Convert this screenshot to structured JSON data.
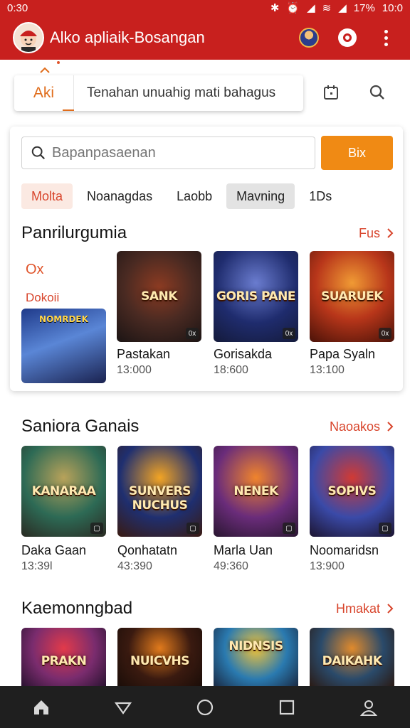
{
  "status": {
    "time": "0:30",
    "battery": "17%",
    "clock": "10:0"
  },
  "app": {
    "title": "Alko apliaik-Bosangan"
  },
  "search": {
    "tab_label": "Aki",
    "query": "Tenahan unuahig mati bahagus"
  },
  "featured": {
    "search_placeholder": "Bapanpasaenan",
    "button_label": "Bix",
    "chips": [
      {
        "label": "Molta"
      },
      {
        "label": "Noanagdas"
      },
      {
        "label": "Laobb"
      },
      {
        "label": "Mavning"
      },
      {
        "label": "1Ds"
      }
    ],
    "title": "Panrilurgumia",
    "link": "Fus",
    "side_label_1": "Ox",
    "side_label_2": "Dokoii",
    "mini_art": "NOMRDEK",
    "items": [
      {
        "art": "SANK",
        "name": "Pastakan",
        "meta": "13:000",
        "badge": "0x",
        "colors": [
          "#4a2a22",
          "#8c3b22",
          "#1b1414"
        ]
      },
      {
        "art": "GORIS PANE",
        "name": "Gorisakda",
        "meta": "18:600",
        "badge": "0x",
        "colors": [
          "#1f2c6e",
          "#6a7ccf",
          "#141a3a"
        ]
      },
      {
        "art": "SUARUEK",
        "name": "Papa Syaln",
        "meta": "13:100",
        "badge": "0x",
        "colors": [
          "#b8361a",
          "#f09a34",
          "#4a1208"
        ]
      }
    ]
  },
  "section2": {
    "title": "Saniora Ganais",
    "link": "Naoakos",
    "items": [
      {
        "art": "KANARAA",
        "name": "Daka Gaan",
        "meta": "13:39l",
        "colors": [
          "#2d6a55",
          "#b8a25a",
          "#2a2a22"
        ]
      },
      {
        "art": "SUNVERS NUCHUS",
        "name": "Qonhatatn",
        "meta": "43:390",
        "colors": [
          "#1f2f70",
          "#f2a424",
          "#3a1a10"
        ]
      },
      {
        "art": "NENEK",
        "name": "Marla Uan",
        "meta": "49:360",
        "colors": [
          "#6a2c7a",
          "#f0842c",
          "#291630"
        ]
      },
      {
        "art": "SOPIVS",
        "name": "Noomaridsn",
        "meta": "13:900",
        "colors": [
          "#3a4aa8",
          "#d13a34",
          "#1c1430"
        ]
      }
    ]
  },
  "section3": {
    "title": "Kaemonngbad",
    "link": "Hmakat",
    "items": [
      {
        "art": "PRAKN",
        "colors": [
          "#7a2c6e",
          "#e23a4a",
          "#2a1230"
        ]
      },
      {
        "art": "NUICVHS",
        "colors": [
          "#3a1a10",
          "#e07a1c",
          "#1a0d08"
        ]
      },
      {
        "art": "NIDNSIS",
        "colors": [
          "#2a7ab0",
          "#f2c43a",
          "#1a2a44"
        ]
      },
      {
        "art": "DAIKAHK",
        "colors": [
          "#2a4a6a",
          "#e08a2c",
          "#2a1a14"
        ]
      }
    ]
  },
  "colors": {
    "brand": "#c8201e",
    "accent": "#f08a14",
    "link": "#d8452c"
  },
  "icons": [
    "home-icon",
    "back-icon",
    "circle-home-icon",
    "recents-icon",
    "profile-icon",
    "search-icon",
    "calendar-icon",
    "chevron-up-icon",
    "chevron-right-icon",
    "more-vertical-icon"
  ]
}
